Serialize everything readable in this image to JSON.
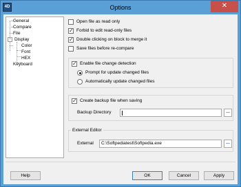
{
  "window": {
    "title": "Options",
    "app_icon_text": "4D",
    "close_glyph": "✕"
  },
  "tree": {
    "items": [
      {
        "label": "General"
      },
      {
        "label": "Compare"
      },
      {
        "label": "File"
      },
      {
        "label": "Display",
        "expander": "−"
      },
      {
        "label": "Color"
      },
      {
        "label": "Font"
      },
      {
        "label": "HEX"
      },
      {
        "label": "Keyboard"
      }
    ]
  },
  "options": {
    "open_read_only": {
      "label": "Open file as read only",
      "checked": false
    },
    "forbid_edit_read_only": {
      "label": "Forbid to edit read-only files",
      "checked": true
    },
    "double_click_merge": {
      "label": "Double clicking on block to merge it",
      "checked": true
    },
    "save_before_compare": {
      "label": "Save files before re-compare",
      "checked": false
    }
  },
  "change_detection": {
    "enable_label": "Enable file change detection",
    "enabled": true,
    "prompt_label": "Prompt for update changed files",
    "prompt_selected": true,
    "auto_label": "Automatically update changed files",
    "auto_selected": false
  },
  "backup": {
    "create_label": "Create backup file when saving",
    "enabled": true,
    "directory_label": "Backup Directory",
    "directory_value": "",
    "browse_label": "..."
  },
  "external_editor": {
    "group_label": "External Editor",
    "field_label": "External",
    "field_value": "C:\\Softpediatest\\Softpedia.exe",
    "browse_label": "..."
  },
  "buttons": {
    "help": "Help",
    "ok": "OK",
    "cancel": "Cancel",
    "apply": "Apply"
  }
}
